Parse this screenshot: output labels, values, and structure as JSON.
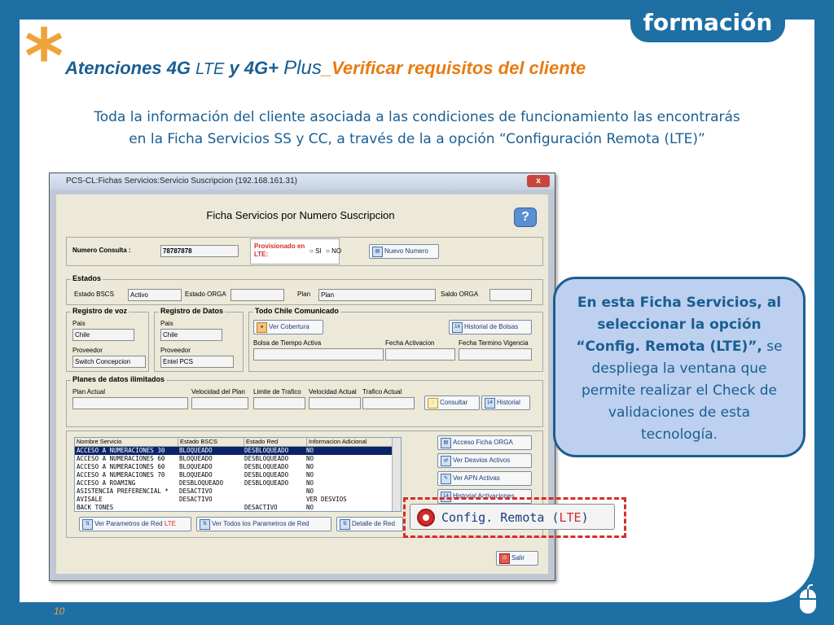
{
  "brand": "formación",
  "title": {
    "star": "*",
    "part1": "Atenciones 4G ",
    "part2": "LTE",
    "part3": " y 4G+ ",
    "part4": "Plus",
    "part5": "_Verificar requisitos del cliente"
  },
  "intro": {
    "line1": "Toda la información del cliente asociada a las condiciones de funcionamiento las encontrarás",
    "line2": "en la Ficha Servicios SS y CC, a través de la a opción “Configuración Remota (LTE)”"
  },
  "window": {
    "title": "PCS-CL:Fichas Servicios:Servicio Suscripcion (192.168.161.31)",
    "close": "x",
    "form_title": "Ficha Servicios por Numero Suscripcion",
    "help": "?",
    "numero_consulta_label": "Numero Consulta :",
    "numero_consulta_value": "78787878",
    "provisionado_label": "Provisionado en LTE:",
    "radio_si": "SI",
    "radio_no": "NO",
    "nuevo_numero": "Nuevo Numero",
    "estados": {
      "group": "Estados",
      "estado_bscs_label": "Estado BSCS",
      "estado_bscs_value": "Activo",
      "estado_orga_label": "Estado ORGA",
      "plan_label": "Plan",
      "plan_value": "Plan",
      "saldo_orga_label": "Saldo ORGA"
    },
    "registro_voz": {
      "group": "Registro de voz",
      "pais_label": "Pais",
      "pais_value": "Chile",
      "proveedor_label": "Proveedor",
      "proveedor_value": "Switch Concepcion"
    },
    "registro_datos": {
      "group": "Registro de Datos",
      "pais_label": "Pais",
      "pais_value": "Chile",
      "proveedor_label": "Proveedor",
      "proveedor_value": "Entel PCS"
    },
    "todo_chile": {
      "group": "Todo Chile Comunicado",
      "ver_cobertura": "Ver Cobertura",
      "historial_bolsas": "Historial de Bolsas",
      "bolsa_label": "Bolsa de Tiempo Activa",
      "fecha_activacion_label": "Fecha Activacion",
      "fecha_termino_label": "Fecha Termino Vigencia"
    },
    "planes": {
      "group": "Planes de datos ilimitados",
      "plan_actual": "Plan Actual",
      "velocidad_plan": "Velocidad del Plan",
      "limite_trafico": "Limite de Trafico",
      "velocidad_actual": "Velocidad Actual",
      "trafico_actual": "Trafico Actual",
      "consultar": "Consultar",
      "historial": "Historial"
    },
    "table": {
      "headers": [
        "Nombre Servicio",
        "Estado BSCS",
        "Estado Red",
        "Informacion Adicional"
      ],
      "rows": [
        [
          "ACCESO A NUMERACIONES 30",
          "BLOQUEADO",
          "DESBLOQUEADO",
          "NO"
        ],
        [
          "ACCESO A NUMERACIONES 60",
          "BLOQUEADO",
          "DESBLOQUEADO",
          "NO"
        ],
        [
          "ACCESO A NUMERACIONES 60",
          "BLOQUEADO",
          "DESBLOQUEADO",
          "NO"
        ],
        [
          "ACCESO A NUMERACIONES 70",
          "BLOQUEADO",
          "DESBLOQUEADO",
          "NO"
        ],
        [
          "ACCESO A ROAMING",
          "DESBLOQUEADO",
          "DESBLOQUEADO",
          "NO"
        ],
        [
          "ASISTENCIA PREFERENCIAL *",
          "DESACTIVO",
          "",
          "NO"
        ],
        [
          "AVISALE",
          "DESACTIVO",
          "",
          "VER DESVIOS"
        ],
        [
          "BACK TONES",
          "",
          "DESACTIVO",
          "NO"
        ]
      ]
    },
    "side_buttons": {
      "acceso_ficha": "Acceso Ficha ORGA",
      "ver_desvios": "Ver Desvios Activos",
      "ver_apn": "Ver APN Activas",
      "historial_activaciones": "Historial Activaciones"
    },
    "bottom_buttons": {
      "ver_parametros": "Ver Parametros de Red",
      "ver_parametros_lte": "LTE",
      "ver_todos": "Ver Todos los Parametros de Red",
      "detalle": "Detalle de Red"
    },
    "salir": "Salir"
  },
  "config_remota": {
    "label": "Config. Remota (",
    "lte": "LTE",
    "close_paren": ")"
  },
  "callout": {
    "bold1": "En esta Ficha Servicios, al seleccionar la opción “Config. Remota (LTE)”,",
    "rest": " se despliega la ventana que permite realizar el Check de validaciones de esta tecnología."
  },
  "page_number": "10"
}
